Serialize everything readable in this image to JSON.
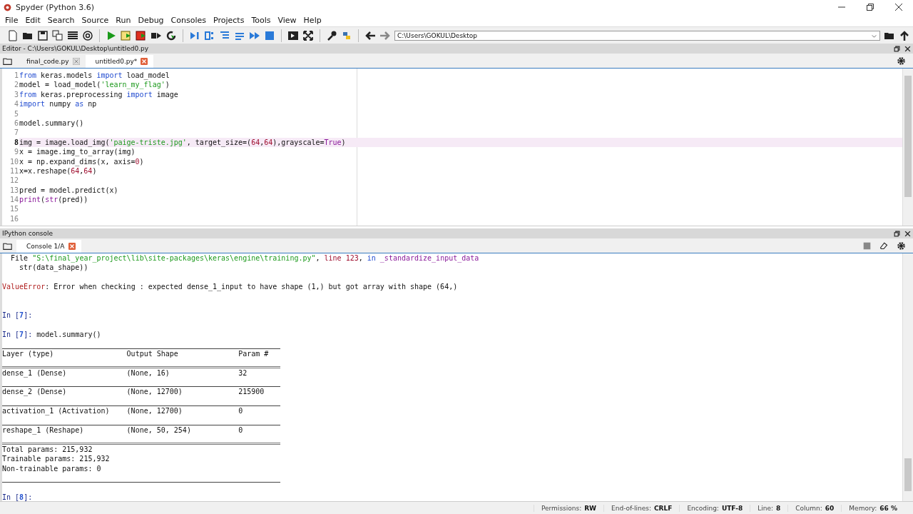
{
  "window": {
    "title": "Spyder (Python 3.6)"
  },
  "menu": [
    "File",
    "Edit",
    "Search",
    "Source",
    "Run",
    "Debug",
    "Consoles",
    "Projects",
    "Tools",
    "View",
    "Help"
  ],
  "path_field": {
    "value": "C:\\Users\\GOKUL\\Desktop"
  },
  "editor": {
    "title": "Editor - C:\\Users\\GOKUL\\Desktop\\untitled0.py",
    "tabs": [
      {
        "label": "final_code.py",
        "selected": false
      },
      {
        "label": "untitled0.py*",
        "selected": true
      }
    ],
    "lines": [
      {
        "number": "1",
        "current": false,
        "tokens": [
          {
            "text": "from",
            "kind": "keyword"
          },
          {
            "text": " keras.models ",
            "kind": "plain"
          },
          {
            "text": "import",
            "kind": "keyword"
          },
          {
            "text": " load_model",
            "kind": "plain"
          }
        ]
      },
      {
        "number": "2",
        "current": false,
        "tokens": [
          {
            "text": "model = load_model(",
            "kind": "plain"
          },
          {
            "text": "'learn_my_flag'",
            "kind": "string"
          },
          {
            "text": ")",
            "kind": "plain"
          }
        ]
      },
      {
        "number": "3",
        "current": false,
        "tokens": [
          {
            "text": "from",
            "kind": "keyword"
          },
          {
            "text": " keras.preprocessing ",
            "kind": "plain"
          },
          {
            "text": "import",
            "kind": "keyword"
          },
          {
            "text": " image",
            "kind": "plain"
          }
        ]
      },
      {
        "number": "4",
        "current": false,
        "tokens": [
          {
            "text": "import",
            "kind": "keyword"
          },
          {
            "text": " numpy ",
            "kind": "plain"
          },
          {
            "text": "as",
            "kind": "keyword"
          },
          {
            "text": " np",
            "kind": "plain"
          }
        ]
      },
      {
        "number": "5",
        "current": false
      },
      {
        "number": "6",
        "current": false,
        "tokens": [
          {
            "text": "model.summary()",
            "kind": "plain"
          }
        ]
      },
      {
        "number": "7",
        "current": false
      },
      {
        "number": "8",
        "current": true,
        "tokens": [
          {
            "text": "img = image.load_img(",
            "kind": "plain"
          },
          {
            "text": "'paige-triste.jpg'",
            "kind": "string"
          },
          {
            "text": ", target_size=(",
            "kind": "plain"
          },
          {
            "text": "64",
            "kind": "number"
          },
          {
            "text": ",",
            "kind": "plain"
          },
          {
            "text": "64",
            "kind": "number"
          },
          {
            "text": "),grayscale=",
            "kind": "plain"
          },
          {
            "text": "True",
            "kind": "builtin"
          },
          {
            "text": ")",
            "kind": "plain"
          }
        ]
      },
      {
        "number": "9",
        "current": false,
        "tokens": [
          {
            "text": "x = image.img_to_array(img)",
            "kind": "plain"
          }
        ]
      },
      {
        "number": "10",
        "current": false,
        "tokens": [
          {
            "text": "x = np.expand_dims(x, axis=",
            "kind": "plain"
          },
          {
            "text": "0",
            "kind": "number"
          },
          {
            "text": ")",
            "kind": "plain"
          }
        ]
      },
      {
        "number": "11",
        "current": false,
        "tokens": [
          {
            "text": "x=x.reshape(",
            "kind": "plain"
          },
          {
            "text": "64",
            "kind": "number"
          },
          {
            "text": ",",
            "kind": "plain"
          },
          {
            "text": "64",
            "kind": "number"
          },
          {
            "text": ")",
            "kind": "plain"
          }
        ]
      },
      {
        "number": "12",
        "current": false
      },
      {
        "number": "13",
        "current": false,
        "tokens": [
          {
            "text": "pred = model.predict(x)",
            "kind": "plain"
          }
        ]
      },
      {
        "number": "14",
        "current": false,
        "tokens": [
          {
            "text": "print",
            "kind": "builtin"
          },
          {
            "text": "(",
            "kind": "plain"
          },
          {
            "text": "str",
            "kind": "builtin"
          },
          {
            "text": "(pred))",
            "kind": "plain"
          }
        ]
      },
      {
        "number": "15",
        "current": false
      },
      {
        "number": "16",
        "current": false
      }
    ]
  },
  "console": {
    "title": "IPython console",
    "tabs": [
      {
        "label": "Console 1/A",
        "selected": true
      }
    ],
    "lines": [
      {
        "kind": "text",
        "tokens": [
          {
            "text": "  File ",
            "kind": "plain"
          },
          {
            "text": "\"S:\\final_year_project\\lib\\site-packages\\keras\\engine\\training.py\"",
            "kind": "string"
          },
          {
            "text": ", ",
            "kind": "plain"
          },
          {
            "text": "line 123",
            "kind": "number"
          },
          {
            "text": ", ",
            "kind": "plain"
          },
          {
            "text": "in ",
            "kind": "keyword"
          },
          {
            "text": "_standardize_input_data",
            "kind": "builtin"
          }
        ]
      },
      {
        "kind": "text",
        "tokens": [
          {
            "text": "    str(data_shape))",
            "kind": "plain"
          }
        ]
      },
      {
        "kind": "blank"
      },
      {
        "kind": "text",
        "tokens": [
          {
            "text": "ValueError",
            "kind": "error"
          },
          {
            "text": ": Error when checking : expected dense_1_input to have shape (1,) but got array with shape (64,)",
            "kind": "plain"
          }
        ]
      },
      {
        "kind": "blank"
      },
      {
        "kind": "blank"
      },
      {
        "kind": "text",
        "tokens": [
          {
            "text": "In [",
            "kind": "prompt"
          },
          {
            "text": "7",
            "kind": "prompt-number"
          },
          {
            "text": "]:",
            "kind": "prompt"
          }
        ]
      },
      {
        "kind": "blank"
      },
      {
        "kind": "text",
        "tokens": [
          {
            "text": "In [",
            "kind": "prompt"
          },
          {
            "text": "7",
            "kind": "prompt-number"
          },
          {
            "text": "]:",
            "kind": "prompt"
          },
          {
            "text": " model.summary()",
            "kind": "plain"
          }
        ]
      },
      {
        "kind": "rule"
      },
      {
        "kind": "text",
        "tokens": [
          {
            "text": "Layer (type)                 Output Shape              Param #",
            "kind": "plain"
          }
        ]
      },
      {
        "kind": "double-rule"
      },
      {
        "kind": "text",
        "tokens": [
          {
            "text": "dense_1 (Dense)              (None, 16)                32",
            "kind": "plain"
          }
        ]
      },
      {
        "kind": "rule"
      },
      {
        "kind": "text",
        "tokens": [
          {
            "text": "dense_2 (Dense)              (None, 12700)             215900",
            "kind": "plain"
          }
        ]
      },
      {
        "kind": "rule"
      },
      {
        "kind": "text",
        "tokens": [
          {
            "text": "activation_1 (Activation)    (None, 12700)             0",
            "kind": "plain"
          }
        ]
      },
      {
        "kind": "rule"
      },
      {
        "kind": "text",
        "tokens": [
          {
            "text": "reshape_1 (Reshape)          (None, 50, 254)           0",
            "kind": "plain"
          }
        ]
      },
      {
        "kind": "double-rule"
      },
      {
        "kind": "text",
        "tokens": [
          {
            "text": "Total params: 215,932",
            "kind": "plain"
          }
        ]
      },
      {
        "kind": "text",
        "tokens": [
          {
            "text": "Trainable params: 215,932",
            "kind": "plain"
          }
        ]
      },
      {
        "kind": "text",
        "tokens": [
          {
            "text": "Non-trainable params: 0",
            "kind": "plain"
          }
        ]
      },
      {
        "kind": "rule"
      },
      {
        "kind": "blank"
      },
      {
        "kind": "text",
        "tokens": [
          {
            "text": "In [",
            "kind": "prompt"
          },
          {
            "text": "8",
            "kind": "prompt-number"
          },
          {
            "text": "]:",
            "kind": "prompt"
          }
        ]
      }
    ]
  },
  "status_bar": [
    {
      "label": "Permissions:",
      "value": "RW"
    },
    {
      "label": "End-of-lines:",
      "value": "CRLF"
    },
    {
      "label": "Encoding:",
      "value": "UTF-8"
    },
    {
      "label": "Line:",
      "value": "8"
    },
    {
      "label": "Column:",
      "value": "60"
    },
    {
      "label": "Memory:",
      "value": "66 %"
    }
  ]
}
